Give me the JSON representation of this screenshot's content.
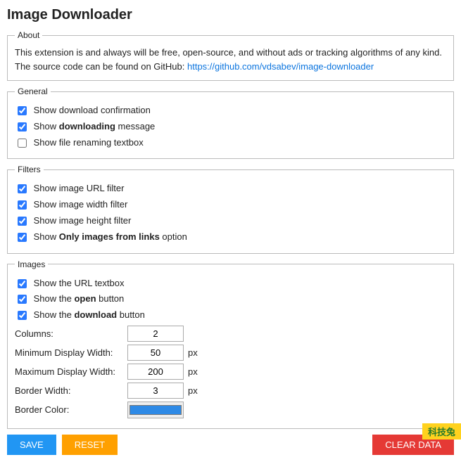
{
  "title": "Image Downloader",
  "about": {
    "legend": "About",
    "text": "This extension is and always will be free, open-source, and without ads or tracking algorithms of any kind.",
    "source_prefix": "The source code can be found on GitHub: ",
    "source_url": "https://github.com/vdsabev/image-downloader"
  },
  "general": {
    "legend": "General",
    "show_download_confirmation": {
      "checked": true,
      "label_pre": "Show download confirmation",
      "label_bold": "",
      "label_post": ""
    },
    "show_downloading_message": {
      "checked": true,
      "label_pre": "Show ",
      "label_bold": "downloading",
      "label_post": " message"
    },
    "show_file_renaming_textbox": {
      "checked": false,
      "label_pre": "Show file renaming textbox",
      "label_bold": "",
      "label_post": ""
    }
  },
  "filters": {
    "legend": "Filters",
    "show_url_filter": {
      "checked": true,
      "label_pre": "Show image URL filter",
      "label_bold": "",
      "label_post": ""
    },
    "show_width_filter": {
      "checked": true,
      "label_pre": "Show image width filter",
      "label_bold": "",
      "label_post": ""
    },
    "show_height_filter": {
      "checked": true,
      "label_pre": "Show image height filter",
      "label_bold": "",
      "label_post": ""
    },
    "show_only_from_links": {
      "checked": true,
      "label_pre": "Show ",
      "label_bold": "Only images from links",
      "label_post": " option"
    }
  },
  "images": {
    "legend": "Images",
    "show_url_textbox": {
      "checked": true,
      "label_pre": "Show the URL textbox",
      "label_bold": "",
      "label_post": ""
    },
    "show_open_button": {
      "checked": true,
      "label_pre": "Show the ",
      "label_bold": "open",
      "label_post": " button"
    },
    "show_download_button": {
      "checked": true,
      "label_pre": "Show the ",
      "label_bold": "download",
      "label_post": " button"
    },
    "columns_label": "Columns:",
    "columns_value": "2",
    "min_width_label": "Minimum Display Width:",
    "min_width_value": "50",
    "max_width_label": "Maximum Display Width:",
    "max_width_value": "200",
    "border_width_label": "Border Width:",
    "border_width_value": "3",
    "border_color_label": "Border Color:",
    "border_color_value": "#2e8ae6",
    "unit_px": "px"
  },
  "buttons": {
    "save": "SAVE",
    "reset": "RESET",
    "clear": "CLEAR DATA"
  },
  "watermark": "科技兔"
}
